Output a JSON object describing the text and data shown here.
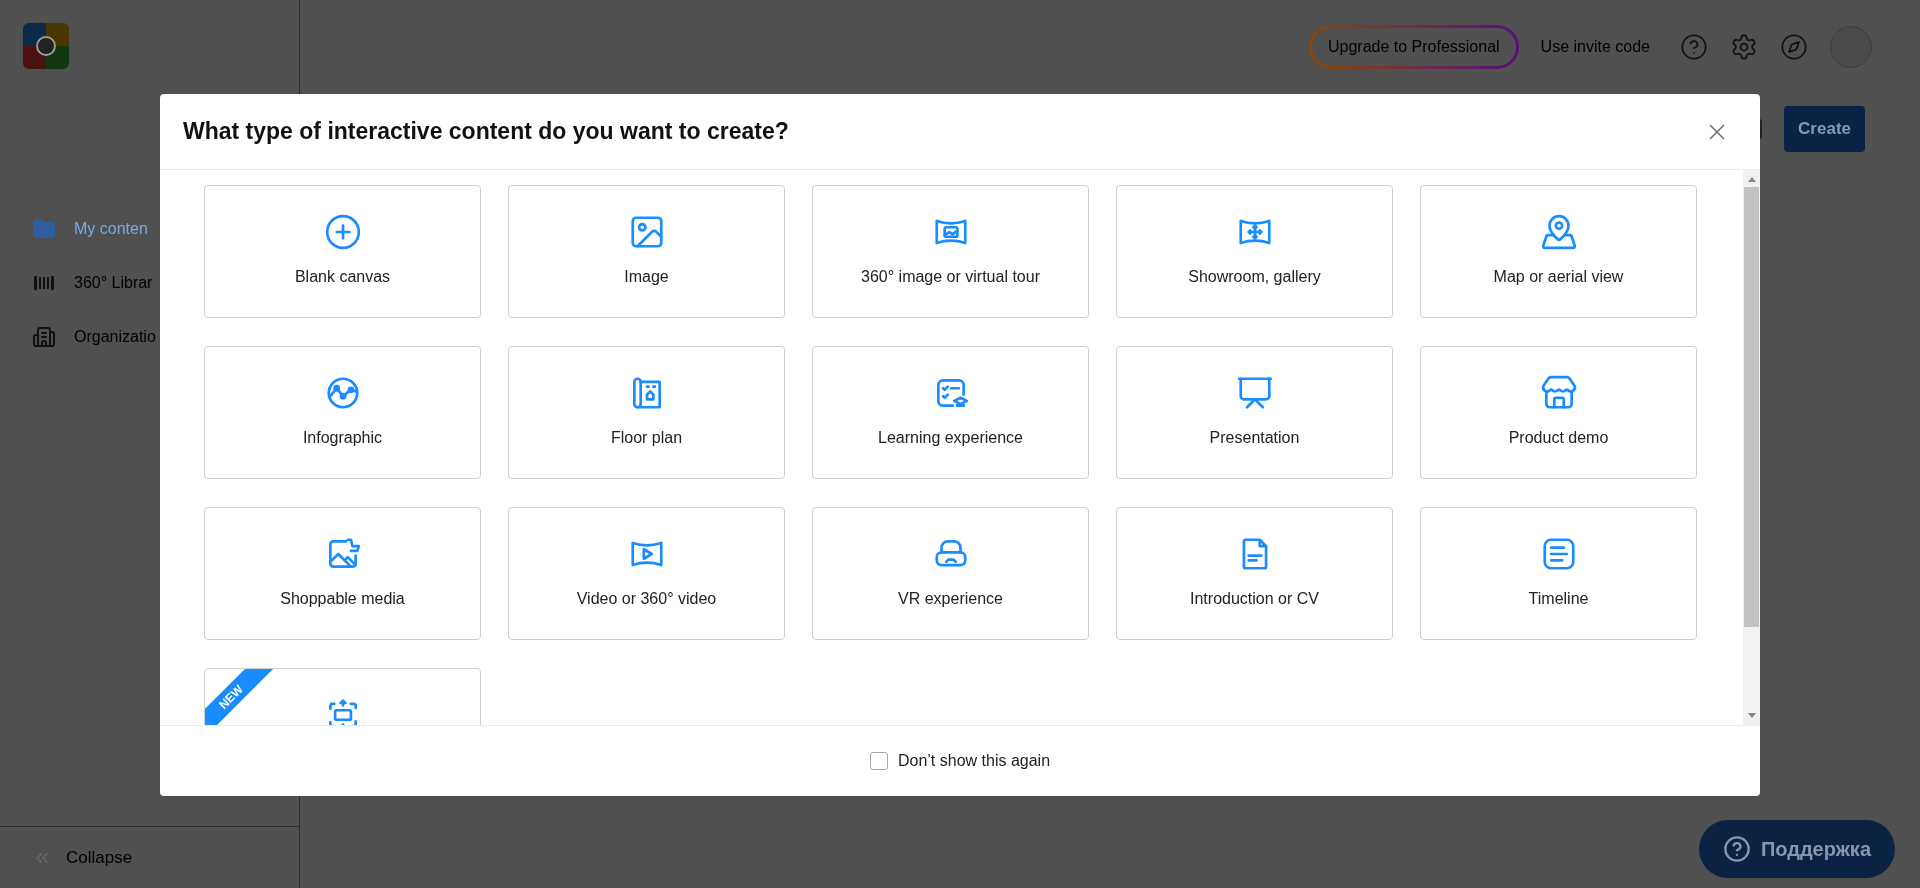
{
  "top_bar": {
    "upgrade_button": "Upgrade to Professional",
    "invite_link": "Use invite code"
  },
  "sidebar": {
    "items": [
      {
        "label": "My conten",
        "selected": true
      },
      {
        "label": "360° Librar",
        "selected": false
      },
      {
        "label": "Organizatio",
        "selected": false
      }
    ],
    "collapse": "Collapse"
  },
  "toolbar": {
    "create_button": "Create"
  },
  "dialog": {
    "title": "What type of interactive content do you want to create?",
    "options": [
      {
        "label": "Blank canvas"
      },
      {
        "label": "Image"
      },
      {
        "label": "360° image or virtual tour"
      },
      {
        "label": "Showroom, gallery"
      },
      {
        "label": "Map or aerial view"
      },
      {
        "label": "Infographic"
      },
      {
        "label": "Floor plan"
      },
      {
        "label": "Learning experience"
      },
      {
        "label": "Presentation"
      },
      {
        "label": "Product demo"
      },
      {
        "label": "Shoppable media"
      },
      {
        "label": "Video or 360° video"
      },
      {
        "label": "VR experience"
      },
      {
        "label": "Introduction or CV"
      },
      {
        "label": "Timeline"
      },
      {
        "badge": "NEW"
      }
    ],
    "dont_show_again": {
      "label": "Don’t show this again",
      "checked": false
    }
  },
  "support_button": "Поддержка"
}
